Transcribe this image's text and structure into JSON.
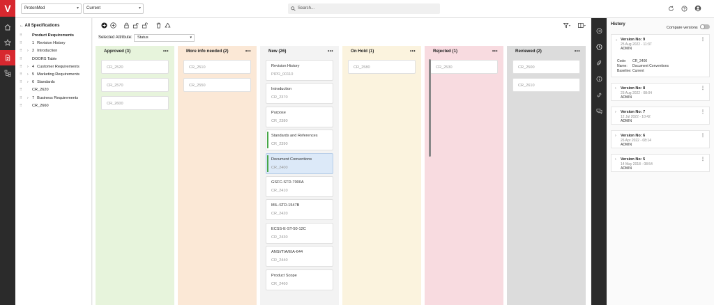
{
  "brand": {
    "logo": "V",
    "accent": "#d7282f",
    "rail_bg": "#2b2b2b"
  },
  "left_rail": {
    "icons": [
      "home-icon",
      "star-icon",
      "document-icon",
      "hierarchy-icon"
    ],
    "active": "document-icon"
  },
  "topbar": {
    "project": "ProtonMed",
    "baseline": "Current",
    "search_placeholder": "Search...",
    "icons": [
      "refresh-icon",
      "help-icon",
      "user-icon"
    ]
  },
  "tree": {
    "back_label": "All Specifications",
    "items": [
      {
        "number": "",
        "label": "Product Requirements",
        "bold": true,
        "expand": false
      },
      {
        "number": "1",
        "label": "Revision History",
        "expand": false
      },
      {
        "number": "2",
        "label": "Introduction",
        "expand": true
      },
      {
        "number": "",
        "label": "DOORS Table",
        "expand": false
      },
      {
        "number": "4",
        "label": "Customer Requirements",
        "expand": true
      },
      {
        "number": "5",
        "label": "Marketing Requirements",
        "expand": true
      },
      {
        "number": "6",
        "label": "Standards",
        "expand": true
      },
      {
        "number": "",
        "label": "CR_2620",
        "expand": false
      },
      {
        "number": "7",
        "label": "Business Requirements",
        "expand": true
      },
      {
        "number": "",
        "label": "CR_2660",
        "expand": false
      }
    ]
  },
  "board": {
    "attribute_label": "Selected Attribute:",
    "attribute_value": "Status",
    "columns": [
      {
        "title": "Approved (3)",
        "bg": "#e7f4dc",
        "cards": [
          {
            "id": "CR_2520"
          },
          {
            "id": "CR_2570"
          },
          {
            "id": "CR_2600"
          }
        ]
      },
      {
        "title": "More info needed (2)",
        "bg": "#fbe8d6",
        "cards": [
          {
            "id": "CR_2510"
          },
          {
            "id": "CR_2550"
          }
        ]
      },
      {
        "title": "New (26)",
        "bg": "#f3f3f3",
        "cards": [
          {
            "title": "Revision History",
            "id": "PIPR_00110"
          },
          {
            "title": "Introduction",
            "id": "CR_2370"
          },
          {
            "title": "Purpose",
            "id": "CR_2380"
          },
          {
            "title": "Standards and References",
            "id": "CR_2390",
            "marked": true
          },
          {
            "title": "Document Conventions",
            "id": "CR_2400",
            "marked": true,
            "selected": true
          },
          {
            "title": "GSFC-STD-7000A",
            "id": "CR_2410"
          },
          {
            "title": "MIL-STD-1547B",
            "id": "CR_2420"
          },
          {
            "title": "ECSS-E-ST-50-12C",
            "id": "CR_2430"
          },
          {
            "title": "ANSI/TIA/EIA-644",
            "id": "CR_2440"
          },
          {
            "title": "Product Scope",
            "id": "CR_2460"
          }
        ]
      },
      {
        "title": "On Hold (1)",
        "bg": "#fbf3de",
        "cards": [
          {
            "id": "CR_2580"
          }
        ]
      },
      {
        "title": "Rejected (1)",
        "bg": "#f8dbe0",
        "cards": [
          {
            "id": "CR_2530"
          }
        ]
      },
      {
        "title": "Reviewed (2)",
        "bg": "#dcdcdc",
        "cards": [
          {
            "id": "CR_2500"
          },
          {
            "id": "CR_2610"
          }
        ]
      }
    ]
  },
  "history": {
    "title": "History",
    "compare_label": "Compare versions",
    "versions": [
      {
        "title": "Version No: 9",
        "date": "25 Aug 2022 - 11:37",
        "author": "ADMIN",
        "expanded": true,
        "details": [
          {
            "k": "Code:",
            "v": "CR_2400"
          },
          {
            "k": "Name:",
            "v": "Document Conventions"
          },
          {
            "k": "Baseline:",
            "v": "Current"
          }
        ]
      },
      {
        "title": "Version No: 8",
        "date": "23 Aug 2022 - 08:04",
        "author": "ADMIN"
      },
      {
        "title": "Version No: 7",
        "date": "12 Jul 2022 - 10:42",
        "author": "ADMIN"
      },
      {
        "title": "Version No: 6",
        "date": "26 Apr 2022 - 08:14",
        "author": "ADMIN"
      },
      {
        "title": "Version No: 5",
        "date": "14 May 2018 - 08:54",
        "author": "ADMIN"
      }
    ]
  }
}
